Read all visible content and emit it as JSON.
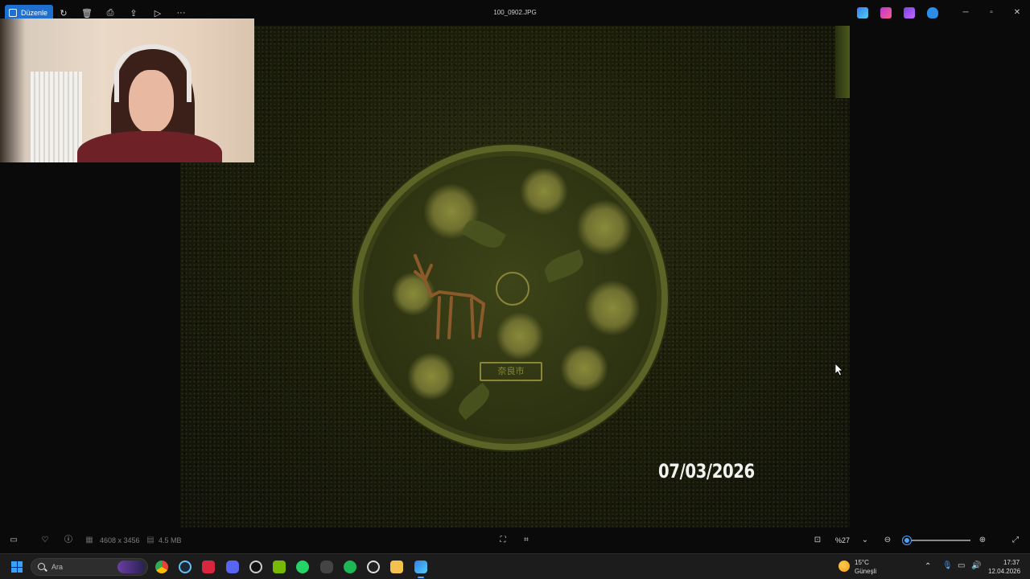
{
  "titlebar": {
    "edit_label": "Düzenle",
    "filename": "100_0902.JPG",
    "more_label": "···"
  },
  "photo": {
    "date_stamp": "07/03/2026",
    "plate_text": "奈良市"
  },
  "bottombar": {
    "dimensions": "4608 x 3456",
    "filesize": "4.5 MB",
    "zoom": "%27",
    "zoom_level_percent": 27
  },
  "taskbar": {
    "search_placeholder": "Ara",
    "weather_temp": "15°C",
    "weather_desc": "Güneşli",
    "time": "17:37",
    "date": "12.04.2026"
  },
  "colors": {
    "accent": "#1f6fd1",
    "slider": "#4aa3ff",
    "taskbar_bg": "#1c1c1c",
    "app_bg": "#0a0a0a"
  },
  "icons": {
    "titlebar": [
      "rotate-icon",
      "delete-icon",
      "print-icon",
      "share-icon",
      "slideshow-icon",
      "more-icon"
    ],
    "titlebar_apps": [
      "paint-icon",
      "clipchamp-icon",
      "designer-icon",
      "onedrive-icon"
    ],
    "taskbar_apps": [
      "chrome-icon",
      "steam-icon",
      "red-app-icon",
      "discord-icon",
      "obs-icon",
      "nvidia-icon",
      "whatsapp-icon",
      "gamepad-icon",
      "spotify-icon",
      "chatgpt-icon",
      "file-explorer-icon",
      "photos-icon"
    ]
  }
}
